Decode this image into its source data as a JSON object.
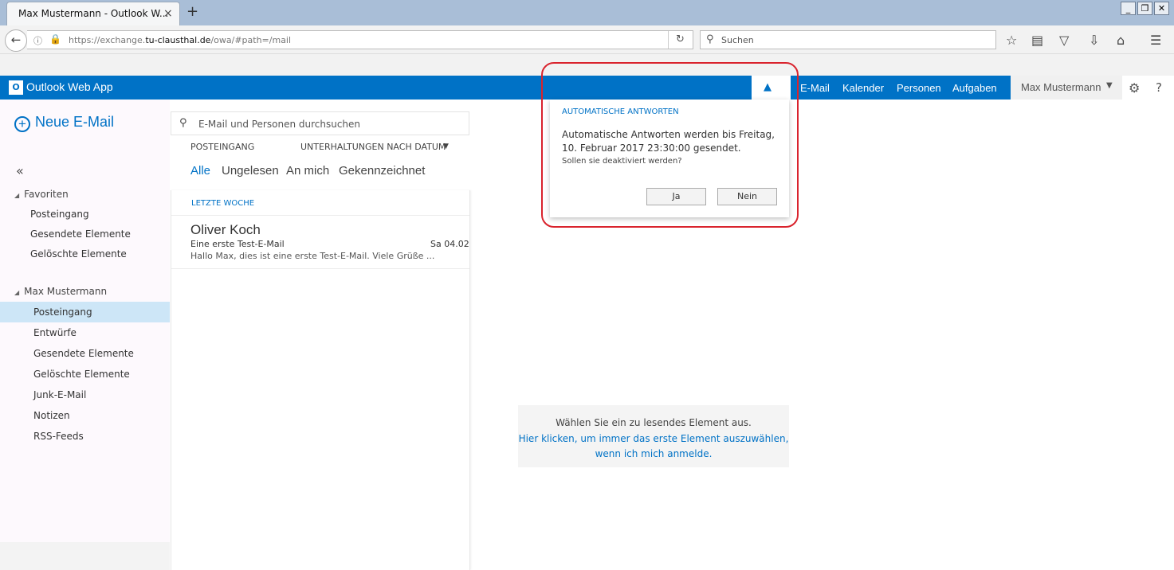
{
  "browser": {
    "tab_title": "Max Mustermann - Outlook W...",
    "tab_close": "×",
    "new_tab": "+",
    "window_buttons": [
      "_",
      "❐",
      "✕"
    ],
    "url_prefix": "https://exchange.",
    "url_host": "tu-clausthal.de",
    "url_path": "/owa/#path=/mail",
    "search_placeholder": "Suchen"
  },
  "owa": {
    "app_title": "Outlook Web App",
    "logo_letters": "O",
    "nav": [
      "E-Mail",
      "Kalender",
      "Personen",
      "Aufgaben"
    ],
    "user": "Max Mustermann",
    "brand_color": "#0072c6"
  },
  "left": {
    "new_mail": "Neue E-Mail",
    "collapse": "«",
    "favorites_label": "Favoriten",
    "favorites": [
      "Posteingang",
      "Gesendete Elemente",
      "Gelöschte Elemente"
    ],
    "account_label": "Max Mustermann",
    "folders": [
      "Posteingang",
      "Entwürfe",
      "Gesendete Elemente",
      "Gelöschte Elemente",
      "Junk-E-Mail",
      "Notizen",
      "RSS-Feeds"
    ],
    "selected_folder": "Posteingang"
  },
  "list": {
    "search_placeholder": "E-Mail und Personen durchsuchen",
    "folder_title": "POSTEINGANG",
    "sort": "UNTERHALTUNGEN NACH DATUM",
    "filters": [
      "Alle",
      "Ungelesen",
      "An mich",
      "Gekennzeichnet"
    ],
    "group_header": "LETZTE WOCHE",
    "messages": [
      {
        "from": "Oliver Koch",
        "subject": "Eine erste Test-E-Mail",
        "date": "Sa 04.02",
        "preview": "Hallo Max,  dies ist eine erste Test-E-Mail.  Viele Grüße  ..."
      }
    ]
  },
  "reading": {
    "hint": "Wählen Sie ein zu lesendes Element aus.",
    "link_line1": "Hier klicken, um immer das erste Element auszuwählen,",
    "link_line2": "wenn ich mich anmelde."
  },
  "popup": {
    "title": "AUTOMATISCHE ANTWORTEN",
    "message": "Automatische Antworten werden bis Freitag, 10. Februar 2017 23:30:00 gesendet.",
    "question": "Sollen sie deaktiviert werden?",
    "yes": "Ja",
    "no": "Nein"
  }
}
